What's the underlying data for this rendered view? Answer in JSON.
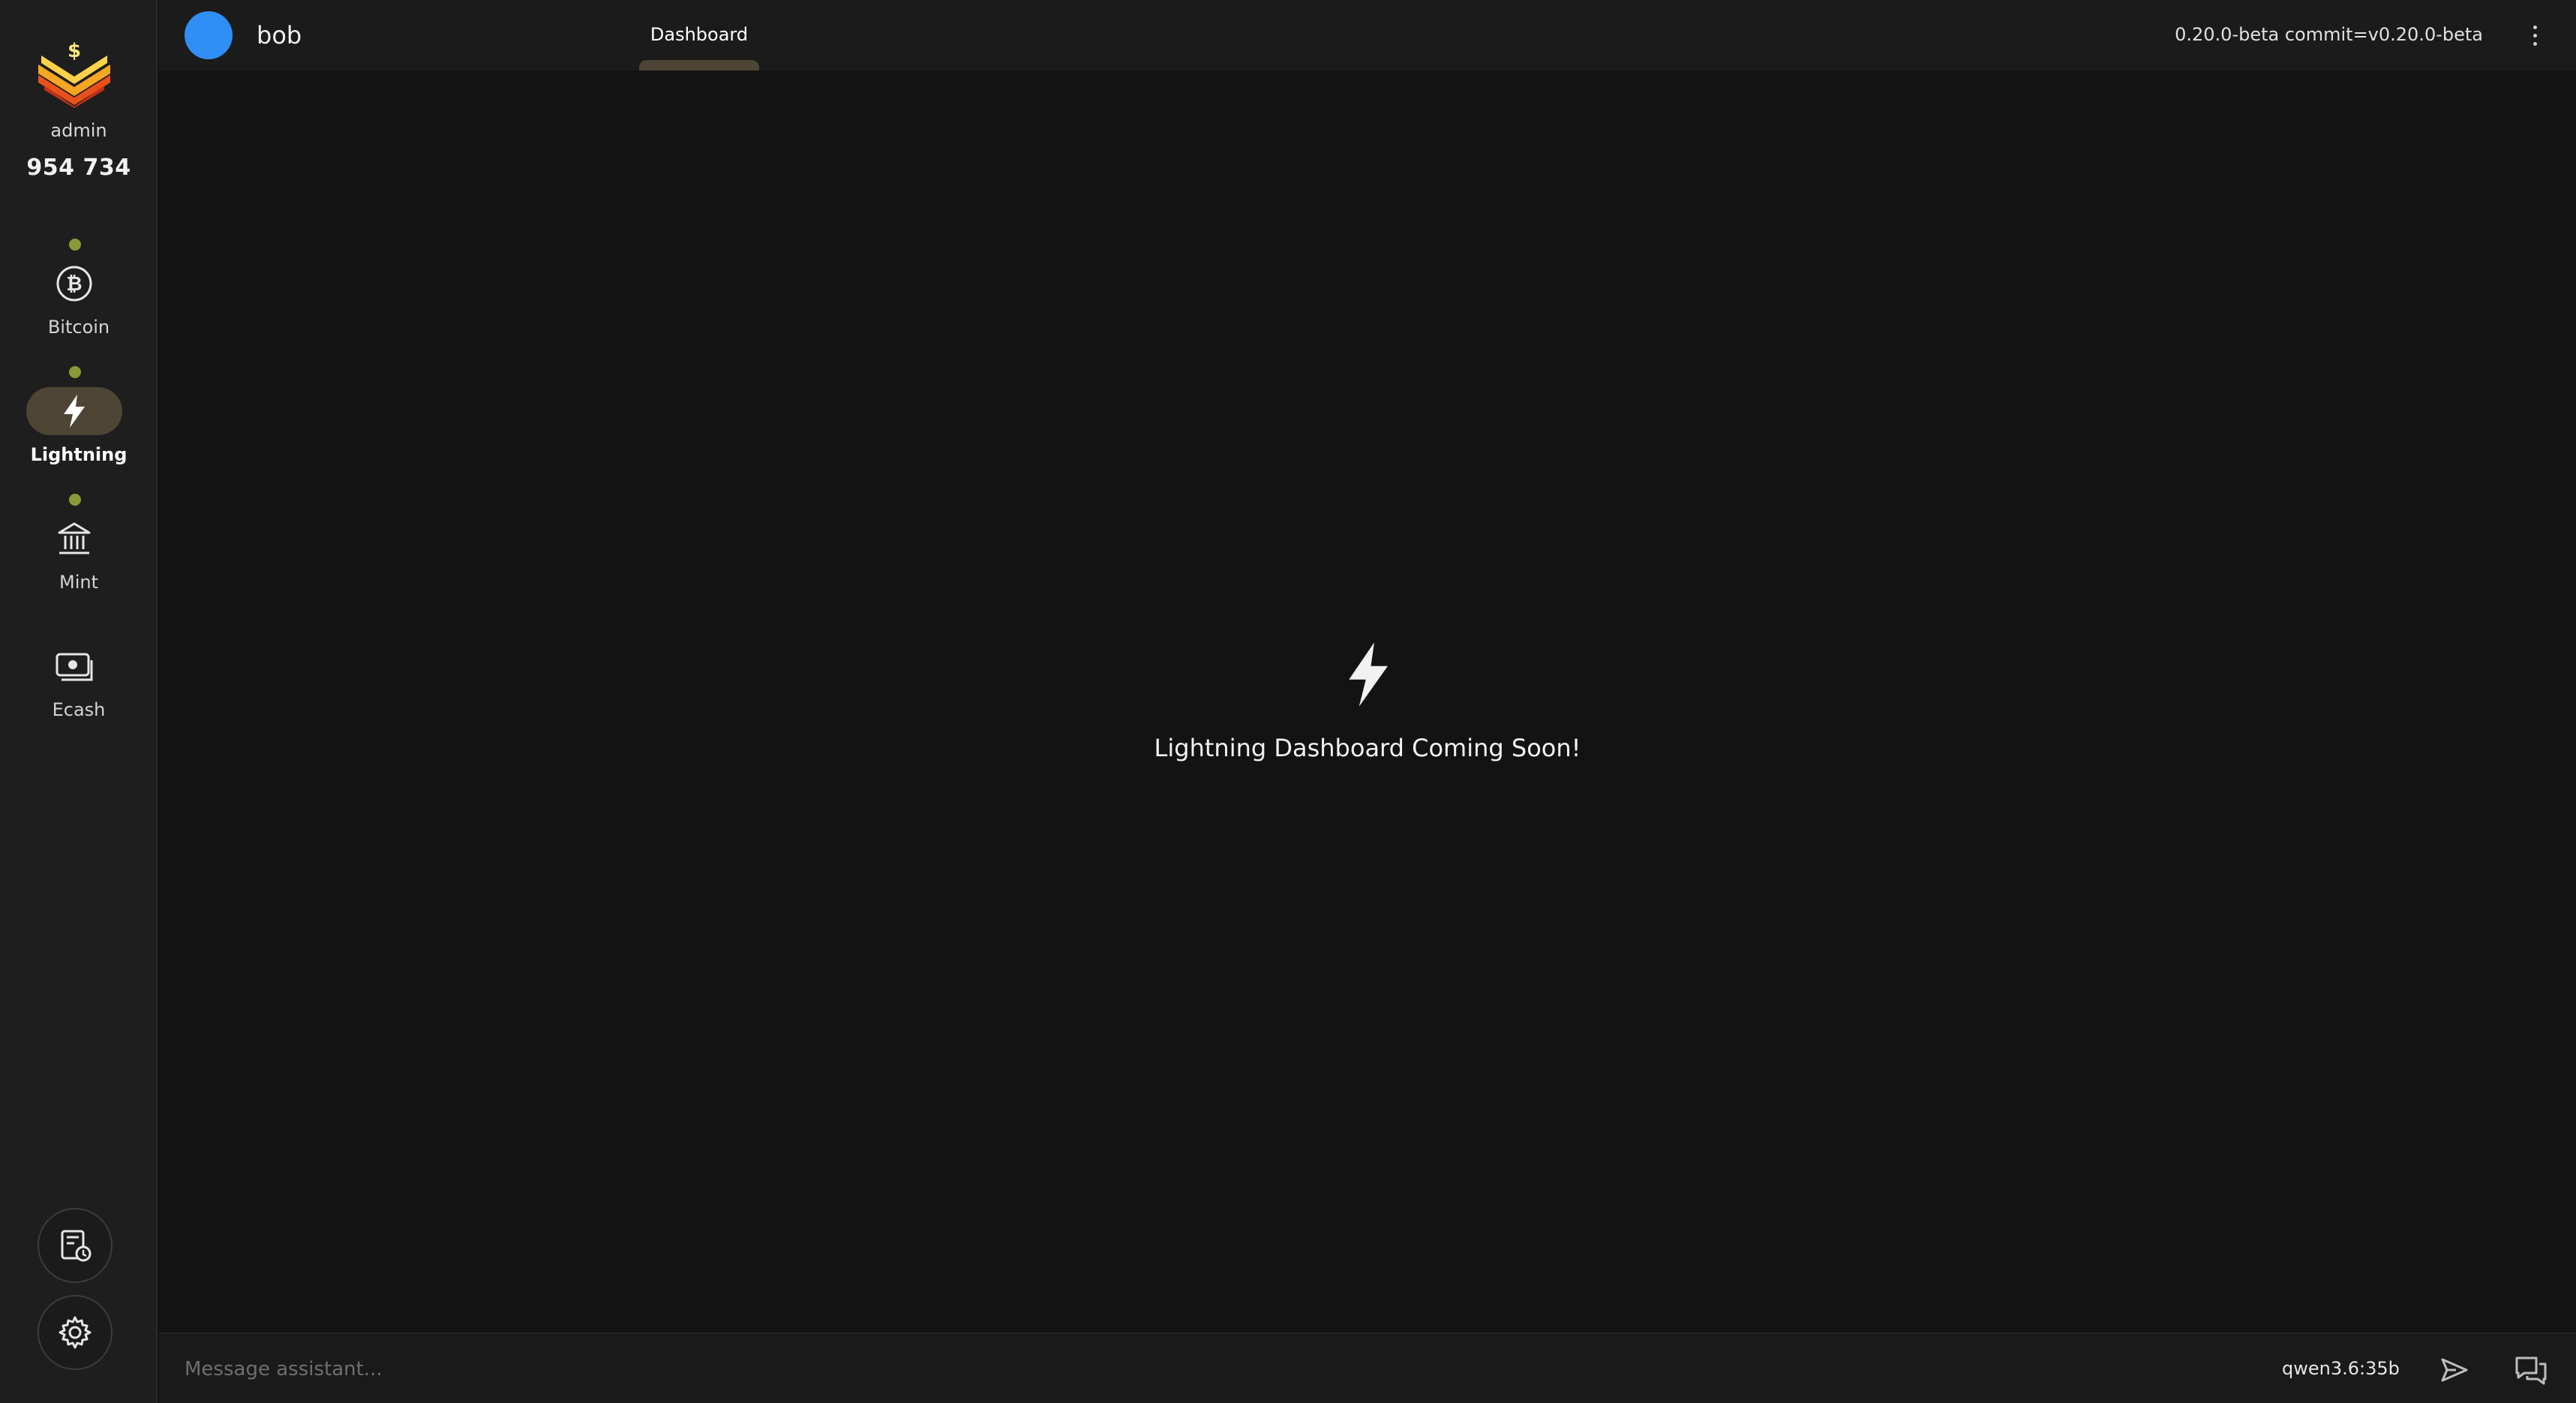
{
  "sidebar": {
    "user_role": "admin",
    "balance": "954 734",
    "items": [
      {
        "label": "Bitcoin",
        "icon": "bitcoin-icon",
        "status": "online",
        "active": false
      },
      {
        "label": "Lightning",
        "icon": "lightning-icon",
        "status": "online",
        "active": true
      },
      {
        "label": "Mint",
        "icon": "bank-icon",
        "status": "online",
        "active": false
      },
      {
        "label": "Ecash",
        "icon": "banknote-icon",
        "active": false
      }
    ],
    "bottom_buttons": [
      "history-icon",
      "gear-icon"
    ]
  },
  "header": {
    "node_name": "bob",
    "avatar_color": "#2f8ff5",
    "tabs": [
      {
        "label": "Dashboard",
        "active": true
      }
    ],
    "version": "0.20.0-beta commit=v0.20.0-beta"
  },
  "main": {
    "empty_icon": "lightning-icon",
    "empty_message": "Lightning Dashboard Coming Soon!"
  },
  "chat": {
    "placeholder": "Message assistant...",
    "model": "qwen3.6:35b"
  },
  "colors": {
    "accent": "#4e4535",
    "status_dot": "#8a9a3a",
    "background": "#131313",
    "sidebar": "#1e1e1e"
  }
}
